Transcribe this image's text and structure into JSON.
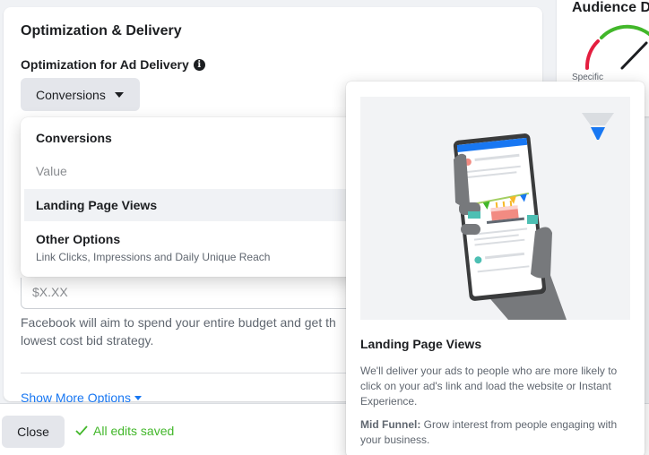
{
  "main": {
    "section_title": "Optimization & Delivery",
    "optimization_label": "Optimization for Ad Delivery",
    "info_glyph": "i",
    "dropdown_value": "Conversions",
    "bid_placeholder": "$X.XX",
    "help_text_line1": "Facebook will aim to spend your entire budget and get th",
    "help_text_line2": "lowest cost bid strategy.",
    "show_more": "Show More Options"
  },
  "menu": {
    "items": [
      {
        "label": "Conversions",
        "state": "normal"
      },
      {
        "label": "Value",
        "state": "disabled"
      },
      {
        "label": "Landing Page Views",
        "state": "hovered"
      },
      {
        "label": "Other Options",
        "sublabel": "Link Clicks, Impressions and Daily Unique Reach",
        "state": "normal"
      }
    ]
  },
  "footer": {
    "close_label": "Close",
    "saved_icon": "check-icon",
    "saved_text": "All edits saved"
  },
  "audience": {
    "title": "Audience D",
    "specific_label": "Specific"
  },
  "tooltip": {
    "title": "Landing Page Views",
    "description": "We'll deliver your ads to people who are more likely to click on your ad's link and load the website or Instant Experience.",
    "funnel_label": "Mid Funnel:",
    "funnel_text": "Grow interest from people engaging with your business."
  },
  "colors": {
    "accent_blue": "#1877f2",
    "success_green": "#42b72a",
    "funnel_blue": "#1877f2",
    "gauge_red": "#e41e3f",
    "gauge_green": "#42b72a"
  }
}
